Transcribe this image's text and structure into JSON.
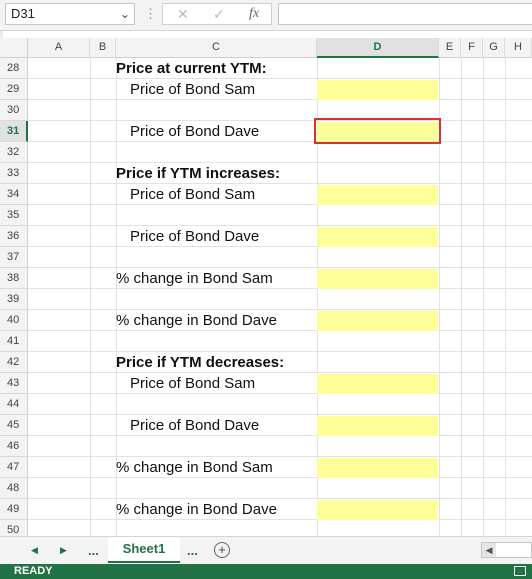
{
  "formula_bar": {
    "name_box": "D31",
    "name_box_dropdown_icon": "chevron-down-icon",
    "separator": "⋮",
    "cancel_icon": "✕",
    "enter_icon": "✓",
    "fx_icon": "fx",
    "formula_value": ""
  },
  "columns": [
    "A",
    "B",
    "C",
    "D",
    "E",
    "F",
    "G",
    "H"
  ],
  "active_column": "D",
  "rows": [
    "28",
    "29",
    "30",
    "31",
    "32",
    "33",
    "34",
    "35",
    "36",
    "37",
    "38",
    "39",
    "40",
    "41",
    "42",
    "43",
    "44",
    "45",
    "46",
    "47",
    "48",
    "49",
    "50"
  ],
  "active_row": "31",
  "column_c_text": {
    "r28": "Price at current YTM:",
    "r29": "Price of Bond Sam",
    "r31": "Price of Bond Dave",
    "r33": "Price if YTM increases:",
    "r34": "Price of Bond Sam",
    "r36": "Price of Bond Dave",
    "r38": "% change in Bond Sam",
    "r40": "% change in Bond Dave",
    "r42": "Price if YTM decreases:",
    "r43": "Price of Bond Sam",
    "r45": "Price of Bond Dave",
    "r47": "% change in Bond Sam",
    "r49": "% change in Bond Dave"
  },
  "input_cell_color": "#ffff99",
  "selection_color": "#d9312b",
  "sheet_tabs": {
    "prev_icon": "◀",
    "next_icon": "▶",
    "more_left": "...",
    "active_sheet": "Sheet1",
    "more_right": "...",
    "add_sheet_icon": "+"
  },
  "status": {
    "mode": "READY"
  },
  "accent_color": "#217346"
}
